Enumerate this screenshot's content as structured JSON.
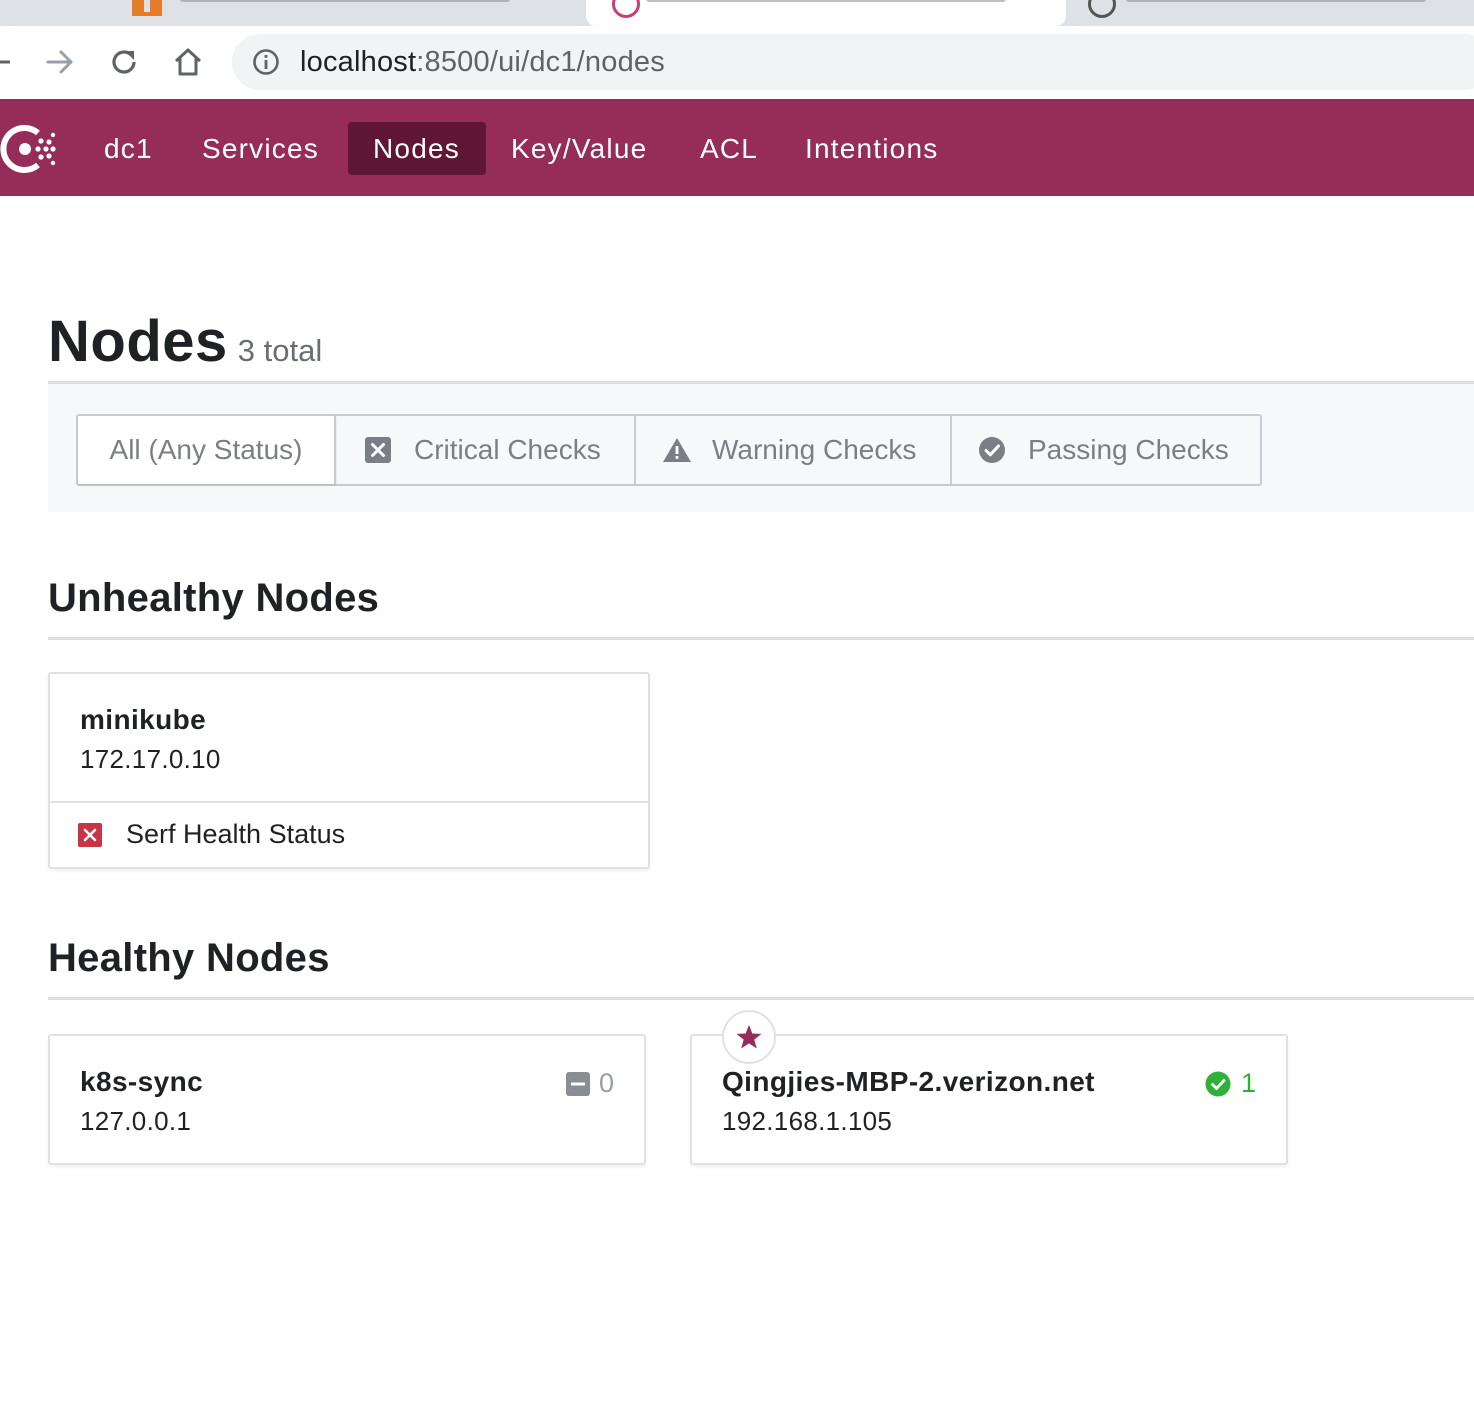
{
  "browser": {
    "url_host": "localhost",
    "url_path": ":8500/ui/dc1/nodes"
  },
  "nav": {
    "datacenter": "dc1",
    "items": [
      {
        "label": "Services"
      },
      {
        "label": "Nodes",
        "active": true
      },
      {
        "label": "Key/Value"
      },
      {
        "label": "ACL"
      },
      {
        "label": "Intentions"
      }
    ]
  },
  "header": {
    "title": "Nodes",
    "count": "3 total"
  },
  "filters": {
    "all": "All (Any Status)",
    "critical": "Critical Checks",
    "warning": "Warning Checks",
    "passing": "Passing Checks"
  },
  "unhealthy": {
    "title": "Unhealthy Nodes",
    "nodes": [
      {
        "name": "minikube",
        "address": "172.17.0.10",
        "checks": [
          {
            "name": "Serf Health Status",
            "status": "critical"
          }
        ]
      }
    ]
  },
  "healthy": {
    "title": "Healthy Nodes",
    "nodes": [
      {
        "name": "k8s-sync",
        "address": "127.0.0.1",
        "count": "0",
        "count_status": "empty"
      },
      {
        "name": "Qingjies-MBP-2.verizon.net",
        "address": "192.168.1.105",
        "count": "1",
        "count_status": "passing",
        "leader": true
      }
    ]
  },
  "colors": {
    "brand": "#962c58",
    "brand_active": "#5e1634",
    "critical": "#c73445",
    "passing": "#2eb039",
    "leader_star": "#962c58"
  },
  "icons": {
    "back": "arrow-left-icon",
    "forward": "arrow-right-icon",
    "reload": "reload-icon",
    "home": "home-icon",
    "info": "info-icon",
    "logo": "consul-logo-icon",
    "critical": "critical-x-icon",
    "warning": "warning-triangle-icon",
    "passing": "passing-check-icon",
    "empty": "minus-square-icon",
    "leader": "star-icon"
  }
}
